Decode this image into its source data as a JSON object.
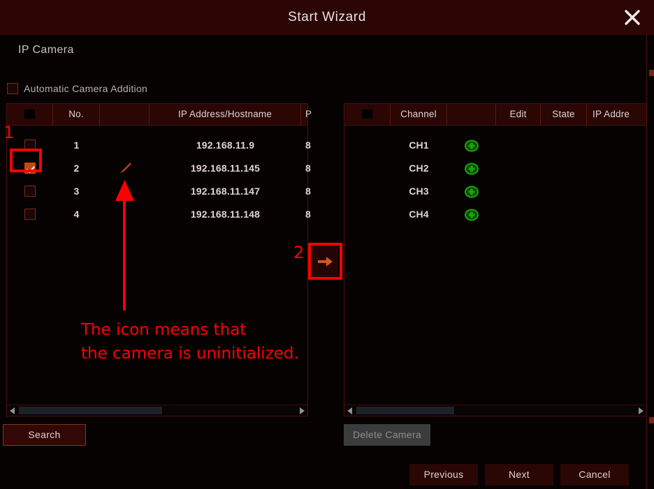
{
  "window": {
    "title": "Start Wizard",
    "close_icon": "close-x-icon"
  },
  "page": {
    "label": "IP Camera"
  },
  "auto_add": {
    "label": "Automatic Camera Addition",
    "checked": false
  },
  "left_table": {
    "columns": [
      "",
      "No.",
      "",
      "IP Address/Hostname",
      "P"
    ],
    "rows": [
      {
        "checked": false,
        "no": "1",
        "edit_icon": "",
        "ip": "192.168.11.9",
        "port": "8"
      },
      {
        "checked": true,
        "no": "2",
        "edit_icon": "pencil-icon",
        "ip": "192.168.11.145",
        "port": "8"
      },
      {
        "checked": false,
        "no": "3",
        "edit_icon": "",
        "ip": "192.168.11.147",
        "port": "8"
      },
      {
        "checked": false,
        "no": "4",
        "edit_icon": "",
        "ip": "192.168.11.148",
        "port": "8"
      }
    ]
  },
  "right_table": {
    "columns": [
      "",
      "Channel",
      "",
      "Edit",
      "State",
      "IP Addre"
    ],
    "rows": [
      {
        "channel": "CH1",
        "status_icon": "green-plus-icon"
      },
      {
        "channel": "CH2",
        "status_icon": "green-plus-icon"
      },
      {
        "channel": "CH3",
        "status_icon": "green-plus-icon"
      },
      {
        "channel": "CH4",
        "status_icon": "green-plus-icon"
      }
    ]
  },
  "transfer": {
    "icon": "arrow-right-icon"
  },
  "buttons": {
    "search": "Search",
    "delete_camera": "Delete Camera",
    "previous": "Previous",
    "next": "Next",
    "cancel": "Cancel"
  },
  "annotations": {
    "step1": "1",
    "step2": "2",
    "note_line1": "The icon means that",
    "note_line2": "the camera is uninitialized.",
    "color": "#fe0000"
  },
  "colors": {
    "window_background": "#060202",
    "titlebar": "#2b0605",
    "table_header": "#2a0605",
    "border": "#4a1208",
    "checkbox_checked": "#c14a14",
    "pencil": "#c2441a",
    "green_status": "#1f8a12",
    "text": "#ded6d0"
  }
}
